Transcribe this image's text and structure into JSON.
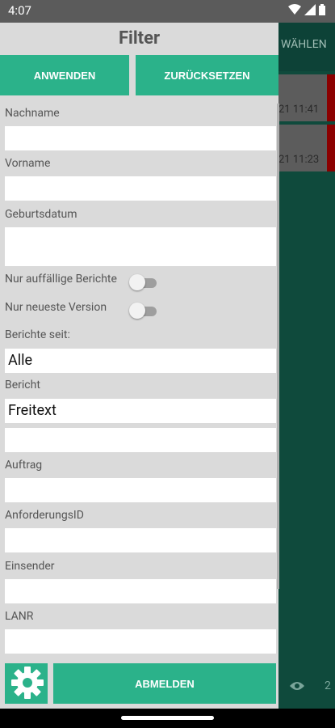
{
  "status_bar": {
    "time": "4:07"
  },
  "background_screen": {
    "header_text": "WÄHLEN",
    "rows": [
      {
        "time": "21 11:41"
      },
      {
        "time": "21 11:23"
      }
    ],
    "bottom_count": "2"
  },
  "drawer": {
    "title": "Filter",
    "apply_label": "ANWENDEN",
    "reset_label": "ZURÜCKSETZEN",
    "fields": {
      "nachname": {
        "label": "Nachname",
        "value": ""
      },
      "vorname": {
        "label": "Vorname",
        "value": ""
      },
      "geburtsdatum": {
        "label": "Geburtsdatum",
        "value": ""
      },
      "berichte_seit": {
        "label": "Berichte seit:",
        "value": "Alle"
      },
      "bericht": {
        "label": "Bericht",
        "value": "Freitext"
      },
      "bericht_extra": {
        "value": ""
      },
      "auftrag": {
        "label": "Auftrag",
        "value": ""
      },
      "anforderungsid": {
        "label": "AnforderungsID",
        "value": ""
      },
      "einsender": {
        "label": "Einsender",
        "value": ""
      },
      "lanr": {
        "label": "LANR",
        "value": ""
      }
    },
    "toggles": {
      "auffaellige": {
        "label": "Nur auffällige Berichte",
        "on": false
      },
      "neueste": {
        "label": "Nur neueste Version",
        "on": false
      }
    },
    "logout_label": "ABMELDEN"
  },
  "colors": {
    "accent": "#2bb28a",
    "app_bg": "#0f4a3c",
    "drawer_bg": "#dadada",
    "alert": "#8b0000"
  }
}
